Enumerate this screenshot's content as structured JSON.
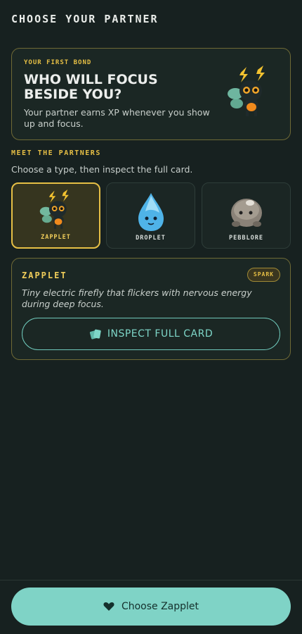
{
  "page": {
    "title": "CHOOSE YOUR PARTNER"
  },
  "intro": {
    "eyebrow": "YOUR FIRST BOND",
    "heading": "WHO WILL FOCUS BESIDE YOU?",
    "description": "Your partner earns XP whenever you show up and focus.",
    "pet_icon": "zapplet-sprite"
  },
  "partners_section": {
    "title": "MEET THE PARTNERS",
    "subtitle": "Choose a type, then inspect the full card.",
    "items": [
      {
        "name": "ZAPPLET",
        "icon": "zapplet-sprite",
        "selected": true
      },
      {
        "name": "DROPLET",
        "icon": "droplet-sprite",
        "selected": false
      },
      {
        "name": "PEBBLORE",
        "icon": "pebblore-sprite",
        "selected": false
      }
    ]
  },
  "detail": {
    "name": "ZAPPLET",
    "type": "SPARK",
    "description": "Tiny electric firefly that flickers with nervous energy during deep focus.",
    "inspect_label": "INSPECT FULL CARD",
    "inspect_icon": "cards-icon"
  },
  "footer": {
    "choose_label": "Choose Zapplet",
    "choose_icon": "heart-icon"
  },
  "colors": {
    "background": "#172120",
    "accent_gold": "#e6bf45",
    "accent_teal": "#7fd3c6"
  }
}
